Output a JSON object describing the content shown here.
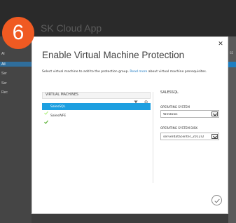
{
  "step_badge": "6",
  "background": {
    "app_title": "SK Cloud App",
    "left_items": [
      "Al",
      "All",
      "Ser",
      "Ser",
      "Rec"
    ],
    "right_header": "SE",
    "accent_color": "#2f6e9c"
  },
  "dialog": {
    "title": "Enable Virtual Machine Protection",
    "subtitle_prefix": "Select virtual machine to add to the protection group. ",
    "subtitle_link": "Read more",
    "subtitle_suffix": " about virtual machine prerequisites.",
    "close_icon": "close-icon",
    "vm_list": {
      "header": "VIRTUAL MACHINES",
      "items": [
        {
          "label": "SalesSQL",
          "selected": true,
          "icon": "check-icon"
        },
        {
          "label": "SalesWFE",
          "selected": false,
          "icon": "check-icon"
        }
      ]
    },
    "details": {
      "title": "SALESSQL",
      "os_label": "OPERATING SYSTEM",
      "os_value": "Windows",
      "disk_label": "OPERATING SYSTEM DISK",
      "disk_value": "serverdatacenter_2012r2"
    },
    "submit_icon": "checkmark-icon"
  },
  "colors": {
    "badge": "#f05a22",
    "selected_row": "#1d9fe0",
    "check_green": "#5fb33a",
    "link": "#1f7bc2"
  }
}
